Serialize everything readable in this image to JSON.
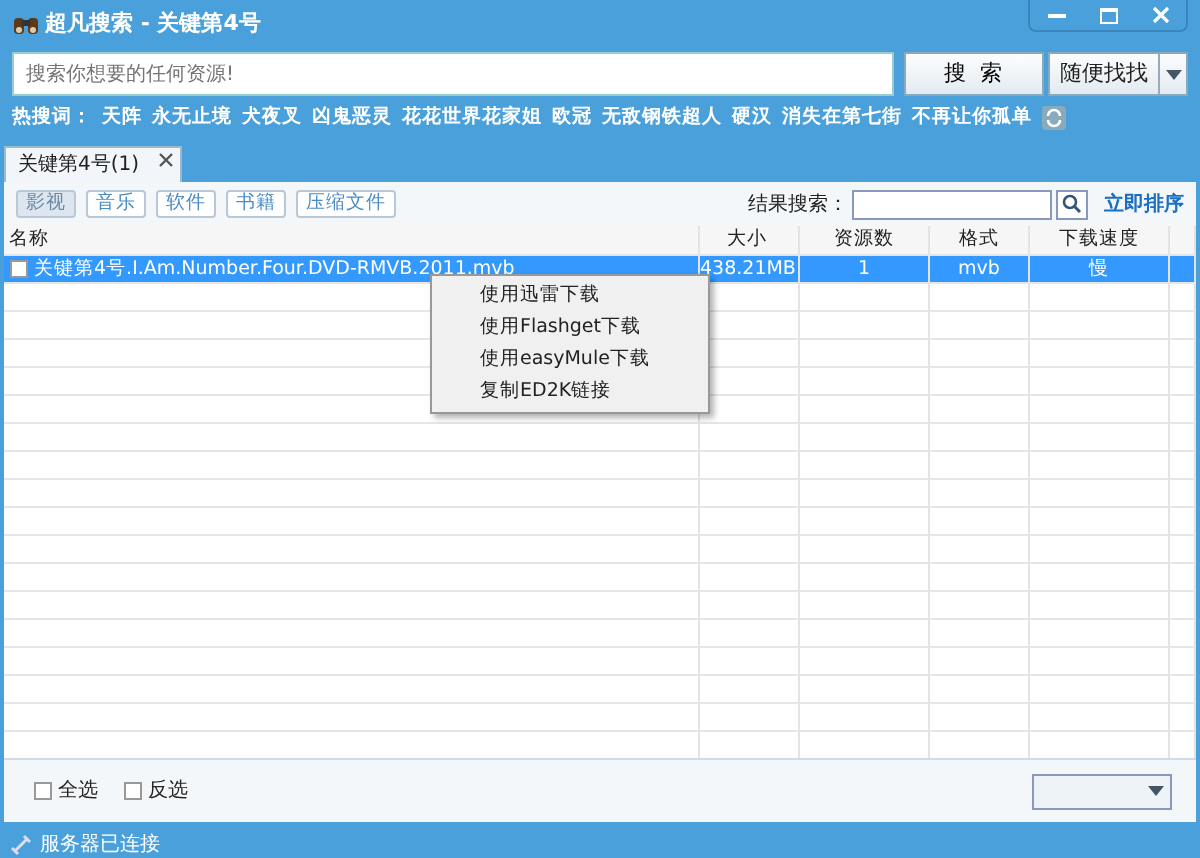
{
  "window": {
    "title": "超凡搜索 - 关键第4号"
  },
  "search": {
    "placeholder": "搜索你想要的任何资源!",
    "buttons": [
      {
        "label": "搜  索",
        "kind": "plain"
      },
      {
        "label": "随便找找",
        "kind": "split"
      }
    ]
  },
  "hot_words": {
    "label": "热搜词：",
    "words": [
      "天阵",
      "永无止境",
      "犬夜叉",
      "凶鬼恶灵",
      "花花世界花家姐",
      "欧冠",
      "无敌钢铁超人",
      "硬汉",
      "消失在第七街",
      "不再让你孤单"
    ]
  },
  "tabs": [
    {
      "label": "关键第4号(1)",
      "selected": true
    }
  ],
  "categories": [
    {
      "label": "影视",
      "selected": true
    },
    {
      "label": "音乐",
      "selected": false
    },
    {
      "label": "软件",
      "selected": false
    },
    {
      "label": "书籍",
      "selected": false
    },
    {
      "label": "压缩文件",
      "selected": false
    }
  ],
  "result_search": {
    "label": "结果搜索：",
    "sort_link": "立即排序"
  },
  "table": {
    "columns": [
      "名称",
      "大小",
      "资源数",
      "格式",
      "下载速度"
    ],
    "rows": [
      {
        "name": "关键第4号.I.Am.Number.Four.DVD-RMVB.2011.mvb",
        "size": "438.21MB",
        "sources": "1",
        "format": "mvb",
        "speed": "慢",
        "checked": false,
        "selected": true
      }
    ]
  },
  "context_menu": [
    "使用迅雷下载",
    "使用Flashget下载",
    "使用easyMule下载",
    "复制ED2K链接"
  ],
  "footer": {
    "checkboxes": [
      {
        "label": "全选",
        "checked": false
      },
      {
        "label": "反选",
        "checked": false
      }
    ]
  },
  "status_bar": "服务器已连接"
}
